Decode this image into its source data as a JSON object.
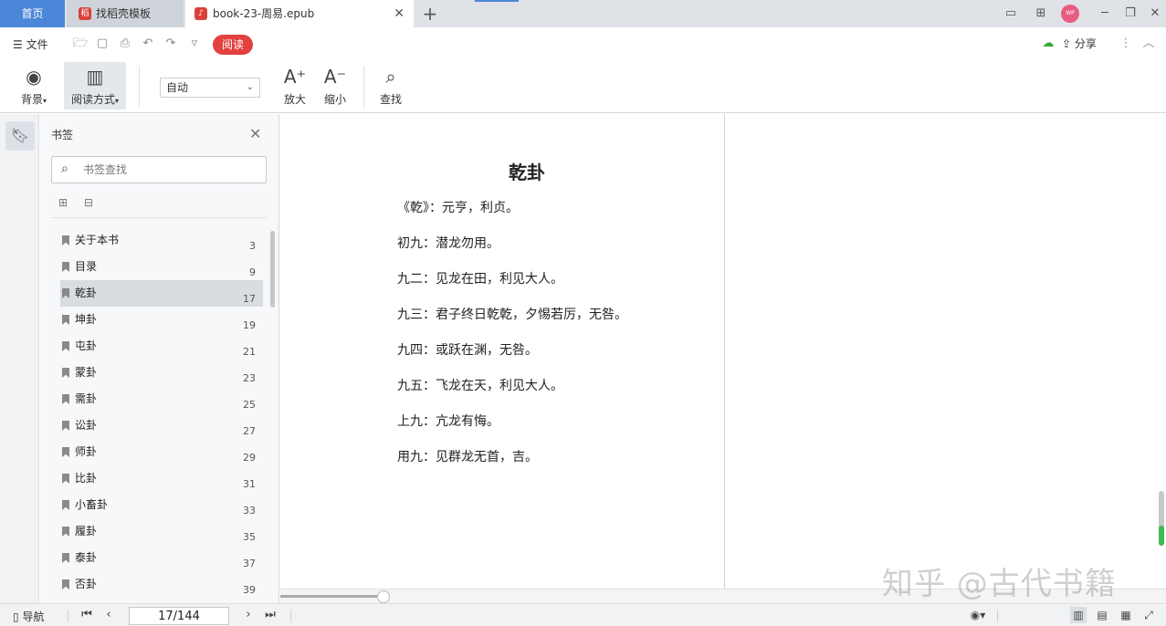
{
  "tabs": {
    "home": "首页",
    "template": "找稻壳模板",
    "document": "book-23-周易.epub",
    "add": "+"
  },
  "quickbar": {
    "file_menu": "文件",
    "read_badge": "阅读",
    "share": "分享",
    "avatar": "WP"
  },
  "ribbon": {
    "background": "背景",
    "read_mode": "阅读方式",
    "zoom_mode": "自动",
    "zoom_in": "放大",
    "zoom_out": "缩小",
    "find": "查找"
  },
  "bookmarks": {
    "title": "书签",
    "search_placeholder": "书签查找",
    "items": [
      {
        "label": "关于本书",
        "page": "3"
      },
      {
        "label": "目录",
        "page": "9"
      },
      {
        "label": "乾卦",
        "page": "17"
      },
      {
        "label": "坤卦",
        "page": "19"
      },
      {
        "label": "屯卦",
        "page": "21"
      },
      {
        "label": "蒙卦",
        "page": "23"
      },
      {
        "label": "需卦",
        "page": "25"
      },
      {
        "label": "讼卦",
        "page": "27"
      },
      {
        "label": "师卦",
        "page": "29"
      },
      {
        "label": "比卦",
        "page": "31"
      },
      {
        "label": "小畜卦",
        "page": "33"
      },
      {
        "label": "履卦",
        "page": "35"
      },
      {
        "label": "泰卦",
        "page": "37"
      },
      {
        "label": "否卦",
        "page": "39"
      }
    ]
  },
  "document": {
    "title": "乾卦",
    "verses": [
      "《乾》：元亨，利贞。",
      "初九：潜龙勿用。",
      "九二：见龙在田，利见大人。",
      "九三：君子终日乾乾，夕惕若厉，无咎。",
      "九四：或跃在渊，无咎。",
      "九五：飞龙在天，利见大人。",
      "上九：亢龙有悔。",
      "用九：见群龙无首，吉。"
    ]
  },
  "watermark": "知乎 @古代书籍",
  "statusbar": {
    "nav": "导航",
    "page_value": "17/144"
  },
  "colors": {
    "accent": "#4b87d8",
    "read_badge": "#e2413f"
  }
}
